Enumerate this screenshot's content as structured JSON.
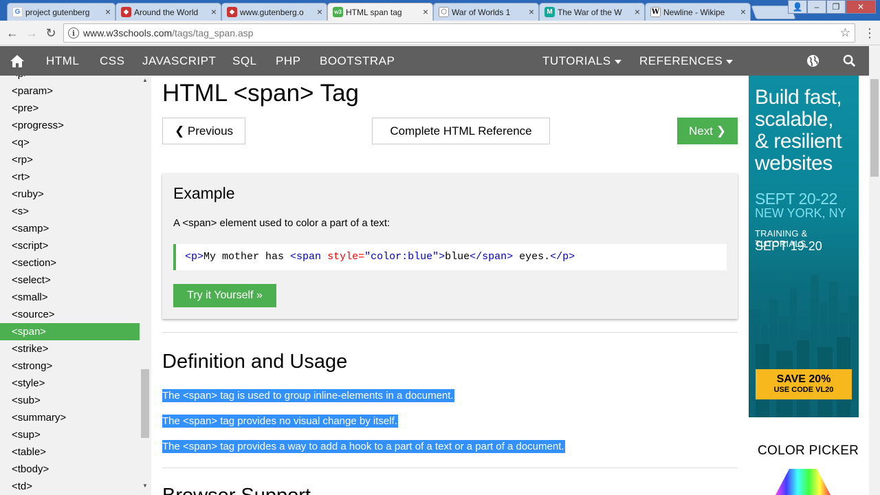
{
  "browser": {
    "tabs": [
      {
        "label": "project gutenberg",
        "favicon": "G",
        "color": "#4285f4"
      },
      {
        "label": "Around the World",
        "favicon": "◆",
        "color": "#c33"
      },
      {
        "label": "www.gutenberg.o",
        "favicon": "◆",
        "color": "#c33"
      },
      {
        "label": "HTML span tag",
        "favicon": "w3",
        "color": "#4caf50"
      },
      {
        "label": "War of Worlds 1",
        "favicon": "⬡",
        "color": "#666"
      },
      {
        "label": "The War of the W",
        "favicon": "M",
        "color": "#1a9"
      },
      {
        "label": "Newline - Wikipe",
        "favicon": "W",
        "color": "#fff"
      }
    ],
    "active_tab": 3,
    "url_host": "www.w3schools.com",
    "url_path": "/tags/tag_span.asp"
  },
  "topnav": {
    "items": [
      "HTML",
      "CSS",
      "JAVASCRIPT",
      "SQL",
      "PHP",
      "BOOTSTRAP"
    ],
    "tutorials": "TUTORIALS",
    "references": "REFERENCES"
  },
  "sidebar": {
    "items": [
      "<p>",
      "<param>",
      "<pre>",
      "<progress>",
      "<q>",
      "<rp>",
      "<rt>",
      "<ruby>",
      "<s>",
      "<samp>",
      "<script>",
      "<section>",
      "<select>",
      "<small>",
      "<source>",
      "<span>",
      "<strike>",
      "<strong>",
      "<style>",
      "<sub>",
      "<summary>",
      "<sup>",
      "<table>",
      "<tbody>",
      "<td>"
    ],
    "active_index": 15
  },
  "main": {
    "title": "HTML <span> Tag",
    "prev": "❮ Previous",
    "ref": "Complete HTML Reference",
    "next": "Next ❯",
    "example_title": "Example",
    "example_desc": "A <span> element used to color a part of a text:",
    "code": {
      "open_p": "<p>",
      "text1": "My mother has ",
      "open_span": "<span",
      "attr": " style=",
      "val": "\"color:blue\"",
      "close_bracket": ">",
      "span_text": "blue",
      "close_span": "</span>",
      "text2": " eyes.",
      "close_p": "</p>"
    },
    "try_btn": "Try it Yourself »",
    "def_title": "Definition and Usage",
    "def_lines": [
      "The <span> tag is used to group inline-elements in a document.",
      "The <span> tag provides no visual change by itself.",
      "The <span> tag provides a way to add a hook to a part of a text or a part of a document."
    ],
    "next_heading": "Browser Support"
  },
  "ad": {
    "line1": "Build fast,",
    "line2": "scalable,",
    "line3": "& resilient",
    "line4": "websites",
    "dates": "SEPT 20-22",
    "city": "NEW YORK, NY",
    "training": "TRAINING & TUTORIALS",
    "training_dates": "SEPT 19-20",
    "save": "SAVE 20%",
    "code": "USE CODE VL20"
  },
  "color_picker": "COLOR PICKER"
}
